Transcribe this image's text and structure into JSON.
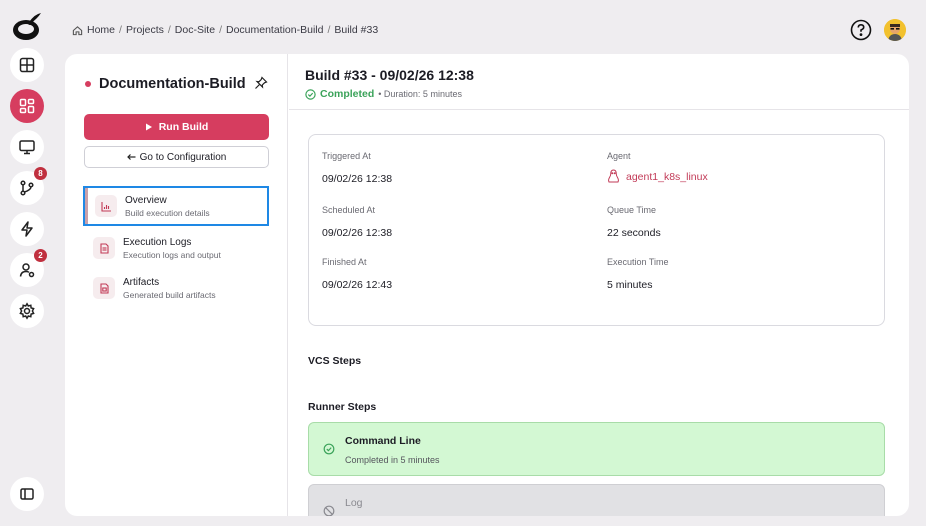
{
  "breadcrumb": {
    "items": [
      "Home",
      "Projects",
      "Doc-Site",
      "Documentation-Build",
      "Build #33"
    ],
    "separator": "/"
  },
  "rail": {
    "nav": [
      {
        "icon": "layout-board-icon",
        "badge": ""
      },
      {
        "icon": "dashboard-grid-icon",
        "badge": "",
        "active": true
      },
      {
        "icon": "monitor-icon",
        "badge": ""
      },
      {
        "icon": "git-branch-icon",
        "badge": "8"
      },
      {
        "icon": "lightning-icon",
        "badge": ""
      },
      {
        "icon": "user-settings-icon",
        "badge": "2"
      },
      {
        "icon": "gear-icon",
        "badge": ""
      }
    ],
    "bottom_icon": "sidebar-toggle-icon"
  },
  "project": {
    "name": "Documentation-Build",
    "run_build_label": "Run Build",
    "go_config_label": "Go to Configuration"
  },
  "menu": [
    {
      "title": "Overview",
      "subtitle": "Build execution details",
      "icon": "chart-icon"
    },
    {
      "title": "Execution Logs",
      "subtitle": "Execution logs and output",
      "icon": "document-icon"
    },
    {
      "title": "Artifacts",
      "subtitle": "Generated build artifacts",
      "icon": "file-icon"
    }
  ],
  "build": {
    "title": "Build #33 - 09/02/26 12:38",
    "status": "Completed",
    "duration": "• Duration: 5 minutes"
  },
  "details": {
    "triggered_label": "Triggered At",
    "triggered_value": "09/02/26 12:38",
    "agent_label": "Agent",
    "agent_value": "agent1_k8s_linux",
    "scheduled_label": "Scheduled At",
    "scheduled_value": "09/02/26 12:38",
    "queue_label": "Queue Time",
    "queue_value": "22 seconds",
    "finished_label": "Finished At",
    "finished_value": "09/02/26 12:43",
    "exec_label": "Execution Time",
    "exec_value": "5 minutes"
  },
  "sections": {
    "vcs": "VCS Steps",
    "runner": "Runner Steps"
  },
  "steps": [
    {
      "name": "Command Line",
      "status": "Completed in 5 minutes"
    },
    {
      "name": "Log",
      "status": ""
    }
  ],
  "colors": {
    "accent": "#d63d5f",
    "success": "#3ba35a",
    "selection": "#1e88e5"
  }
}
